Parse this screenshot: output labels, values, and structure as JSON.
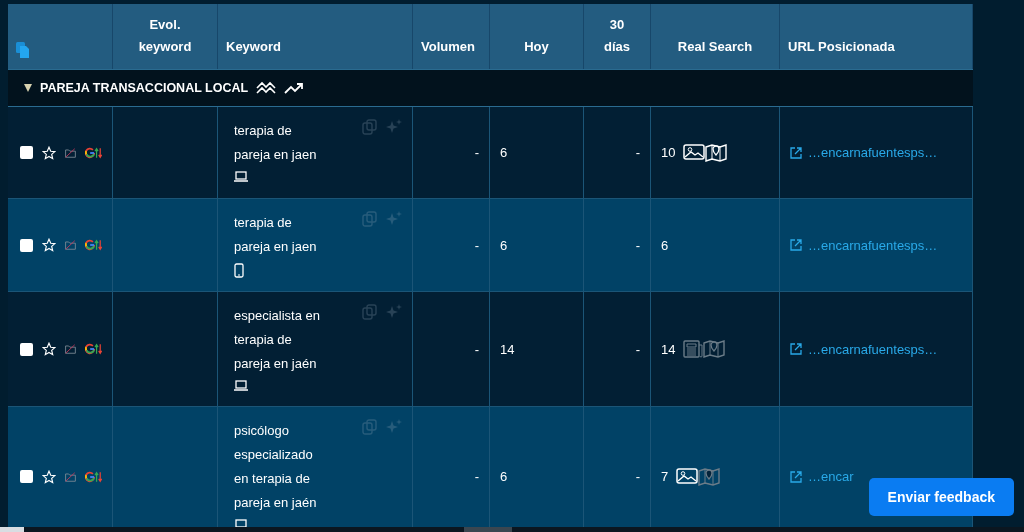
{
  "table": {
    "columns": [
      "Evol. keyword",
      "Keyword",
      "Volumen",
      "Hoy",
      "30 días",
      "Real Search",
      "URL Posicionada"
    ],
    "group": {
      "name": "PAREJA TRANSACCIONAL LOCAL",
      "expanded": true
    },
    "rows": [
      {
        "checked": false,
        "starred": false,
        "keyword": "terapia de pareja en jaen",
        "mobile": false,
        "volumen": "-",
        "hoy": "6",
        "dias30": "-",
        "real_search": "10",
        "features": [
          {
            "kind": "image",
            "active": true
          },
          {
            "kind": "map",
            "active": true
          }
        ],
        "url": "…encarnafuentesps…"
      },
      {
        "checked": false,
        "starred": false,
        "keyword": "terapia de pareja en jaen",
        "mobile": true,
        "volumen": "-",
        "hoy": "6",
        "dias30": "-",
        "real_search": "6",
        "features": [],
        "url": "…encarnafuentesps…"
      },
      {
        "checked": false,
        "starred": false,
        "keyword": "especialista en terapia de pareja en jaén",
        "mobile": false,
        "volumen": "-",
        "hoy": "14",
        "dias30": "-",
        "real_search": "14",
        "features": [
          {
            "kind": "news",
            "active": false
          },
          {
            "kind": "map",
            "active": false
          }
        ],
        "url": "…encarnafuentesps…"
      },
      {
        "checked": false,
        "starred": false,
        "keyword": "psicólogo especializado en terapia de pareja en jaén",
        "mobile": false,
        "volumen": "-",
        "hoy": "6",
        "dias30": "-",
        "real_search": "7",
        "features": [
          {
            "kind": "image",
            "active": true
          },
          {
            "kind": "map",
            "active": false
          }
        ],
        "url": "…encar"
      }
    ]
  },
  "feedback_button": "Enviar feedback"
}
